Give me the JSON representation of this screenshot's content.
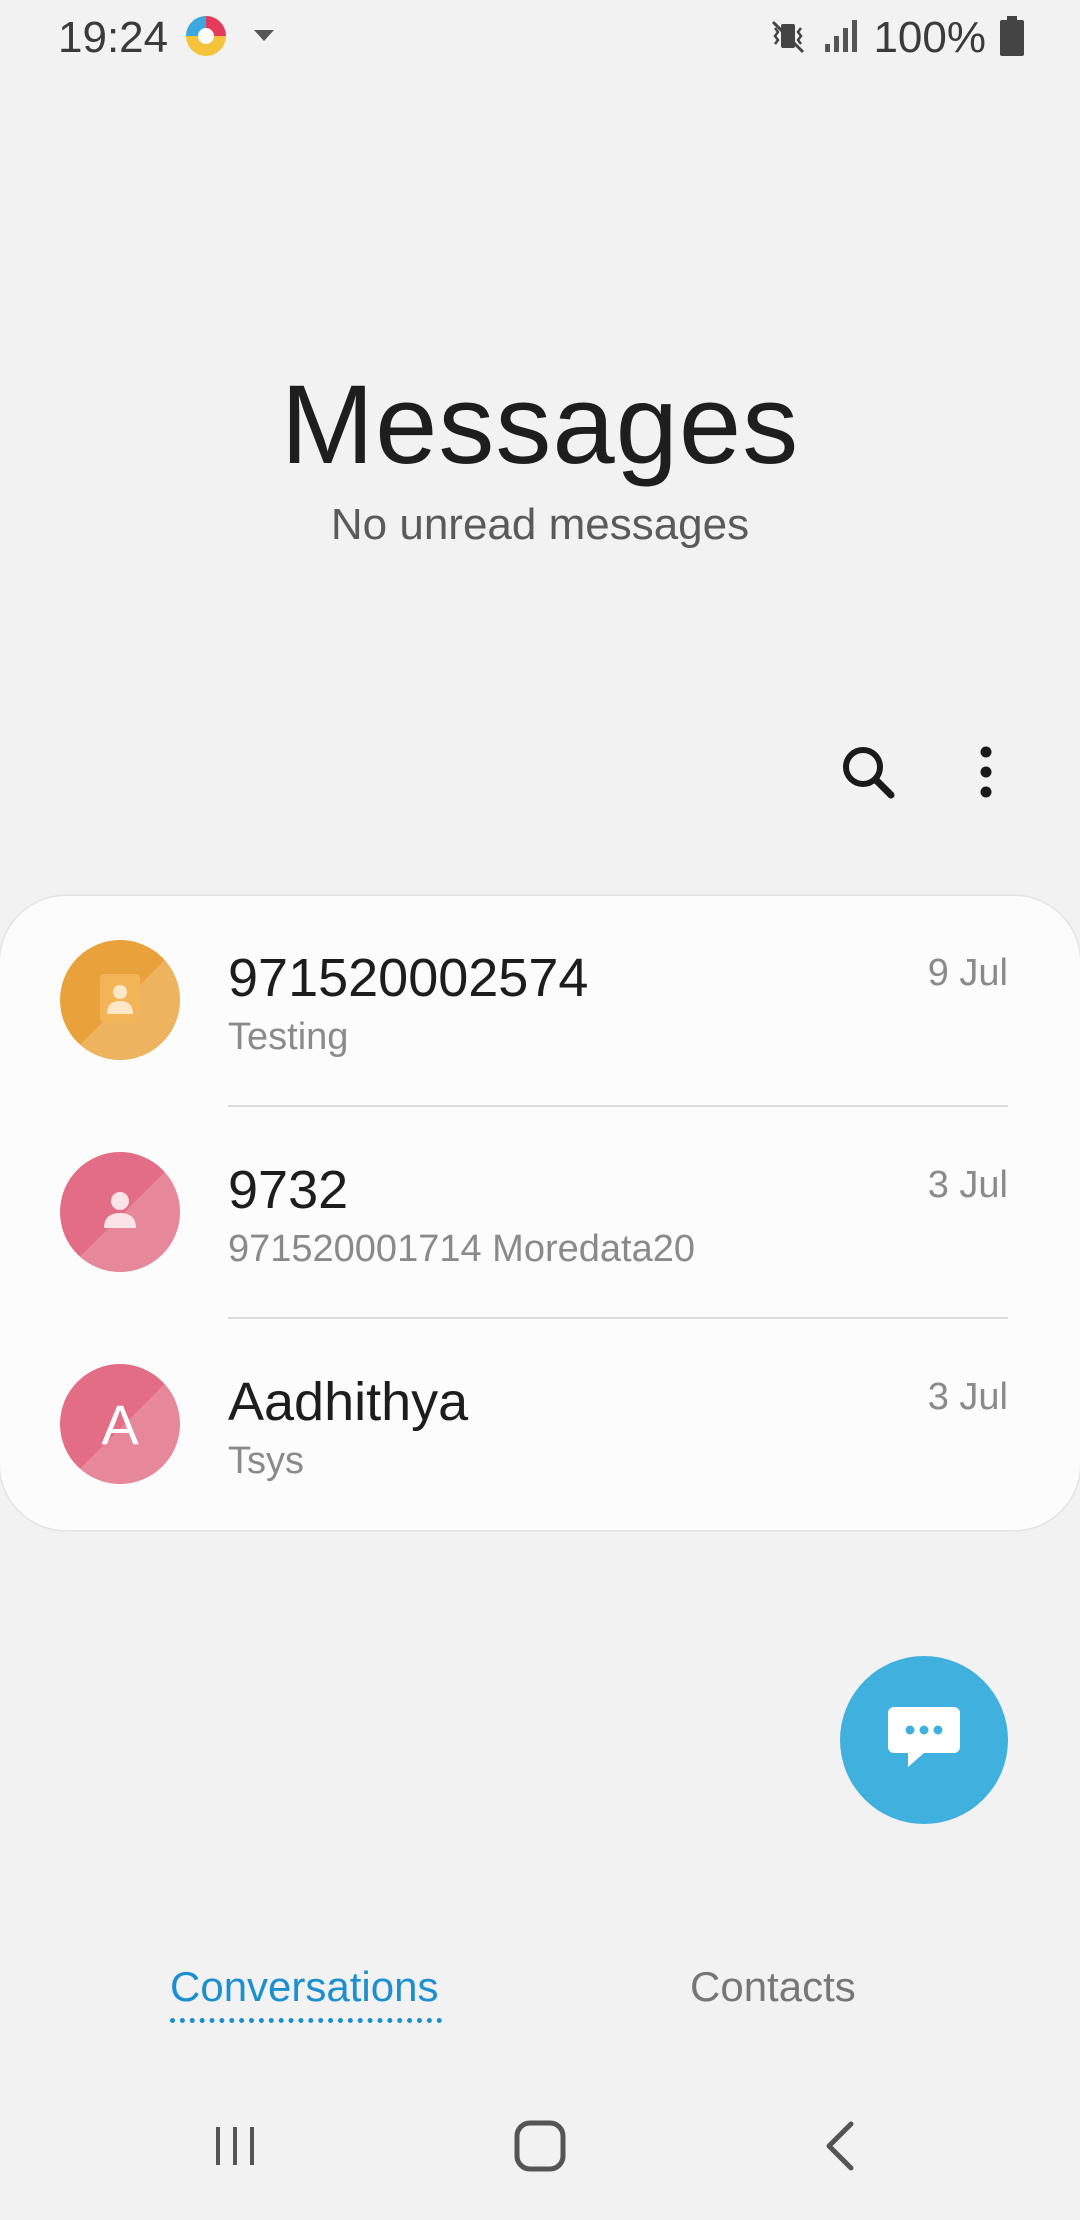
{
  "status_bar": {
    "time": "19:24",
    "battery": "100%",
    "icons": [
      "app-notification-icon",
      "dropdown-caret-icon",
      "vibrate-mute-icon",
      "signal-icon",
      "battery-icon"
    ]
  },
  "header": {
    "title": "Messages",
    "subtitle": "No unread messages"
  },
  "toolbar": {
    "search_icon": "search-icon",
    "more_icon": "more-options-icon"
  },
  "conversations": [
    {
      "name": "971520002574",
      "preview": "Testing",
      "date": "9 Jul",
      "avatar_color": "#e9a23b",
      "avatar_type": "contact-card-icon"
    },
    {
      "name": "9732",
      "preview": "971520001714 Moredata20",
      "date": "3 Jul",
      "avatar_color": "#e26d84",
      "avatar_type": "person-icon"
    },
    {
      "name": "Aadhithya",
      "preview": "Tsys",
      "date": "3 Jul",
      "avatar_color": "#e26d84",
      "avatar_letter": "A"
    }
  ],
  "fab": {
    "icon": "compose-message-icon",
    "color": "#40b0de"
  },
  "tabs": [
    {
      "label": "Conversations",
      "active": true
    },
    {
      "label": "Contacts",
      "active": false
    }
  ],
  "nav_bar": [
    "recent-apps-icon",
    "home-icon",
    "back-icon"
  ],
  "colors": {
    "accent": "#1b8fd0",
    "background": "#f2f2f2"
  }
}
